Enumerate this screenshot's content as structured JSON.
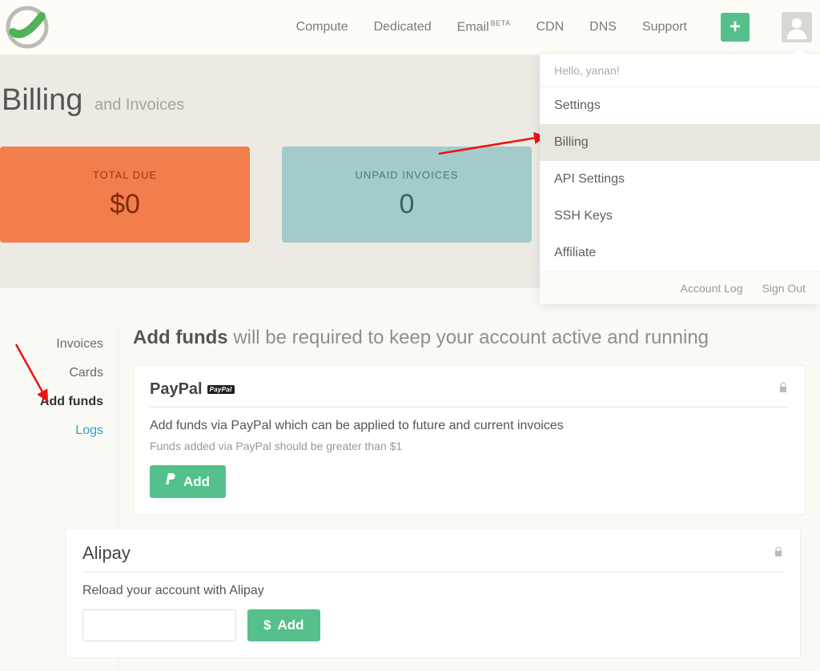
{
  "nav": {
    "items": [
      "Compute",
      "Dedicated",
      "Email",
      "CDN",
      "DNS",
      "Support"
    ],
    "email_badge": "BETA"
  },
  "dropdown": {
    "greeting": "Hello, yanan!",
    "items": [
      "Settings",
      "Billing",
      "API Settings",
      "SSH Keys",
      "Affiliate"
    ],
    "footer": [
      "Account Log",
      "Sign Out"
    ]
  },
  "hero": {
    "title": "Billing",
    "subtitle": "and Invoices",
    "cards": [
      {
        "label": "TOTAL DUE",
        "value": "$0"
      },
      {
        "label": "UNPAID INVOICES",
        "value": "0"
      }
    ]
  },
  "sidetabs": [
    "Invoices",
    "Cards",
    "Add funds",
    "Logs"
  ],
  "main": {
    "title_bold": "Add funds",
    "title_rest": "will be required to keep your account active and running"
  },
  "paypal": {
    "title": "PayPal",
    "badge": "PayPal",
    "desc": "Add funds via PayPal which can be applied to future and current invoices",
    "note": "Funds added via PayPal should be greater than $1",
    "button": "Add"
  },
  "alipay": {
    "title": "Alipay",
    "desc": "Reload your account with Alipay",
    "currency": "$",
    "button": "Add"
  }
}
